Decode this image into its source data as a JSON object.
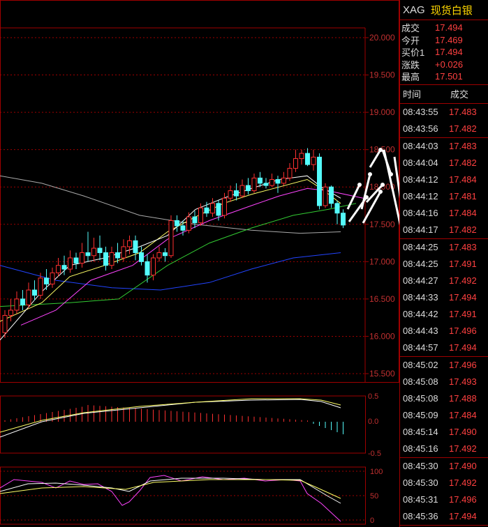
{
  "header": {
    "symbol": "XAG",
    "name": "现货白银"
  },
  "quote": [
    {
      "label": "成交",
      "value": "17.494"
    },
    {
      "label": "今开",
      "value": "17.469"
    },
    {
      "label": "买价1",
      "value": "17.494"
    },
    {
      "label": "涨跌",
      "value": "+0.026"
    },
    {
      "label": "最高",
      "value": "17.501"
    }
  ],
  "ticks_header": {
    "time": "时间",
    "price": "成交"
  },
  "tick_groups": [
    [
      {
        "time": "08:43:55",
        "price": "17.483"
      },
      {
        "time": "08:43:56",
        "price": "17.482"
      }
    ],
    [
      {
        "time": "08:44:03",
        "price": "17.483"
      },
      {
        "time": "08:44:04",
        "price": "17.482"
      },
      {
        "time": "08:44:12",
        "price": "17.484"
      },
      {
        "time": "08:44:12",
        "price": "17.481"
      },
      {
        "time": "08:44:16",
        "price": "17.484"
      },
      {
        "time": "08:44:17",
        "price": "17.482"
      }
    ],
    [
      {
        "time": "08:44:25",
        "price": "17.483"
      },
      {
        "time": "08:44:25",
        "price": "17.491"
      },
      {
        "time": "08:44:27",
        "price": "17.492"
      },
      {
        "time": "08:44:33",
        "price": "17.494"
      },
      {
        "time": "08:44:42",
        "price": "17.491"
      },
      {
        "time": "08:44:43",
        "price": "17.496"
      },
      {
        "time": "08:44:57",
        "price": "17.494"
      }
    ],
    [
      {
        "time": "08:45:02",
        "price": "17.496"
      },
      {
        "time": "08:45:08",
        "price": "17.493"
      },
      {
        "time": "08:45:08",
        "price": "17.488"
      },
      {
        "time": "08:45:09",
        "price": "17.484"
      },
      {
        "time": "08:45:14",
        "price": "17.490"
      },
      {
        "time": "08:45:16",
        "price": "17.492"
      }
    ],
    [
      {
        "time": "08:45:30",
        "price": "17.490"
      },
      {
        "time": "08:45:30",
        "price": "17.492"
      },
      {
        "time": "08:45:31",
        "price": "17.496"
      },
      {
        "time": "08:45:36",
        "price": "17.494"
      }
    ]
  ],
  "colors": {
    "up": "#ff3030",
    "down": "#54fcfc",
    "grid": "#a00000",
    "ma5": "#ffffff",
    "ma10": "#ffff66",
    "ma20": "#ff44ff",
    "ma40": "#33cc33",
    "ma60": "#aaaaaa",
    "ma120": "#2244ff"
  },
  "chart_data": {
    "type": "candlestick",
    "price_axis": {
      "ticks": [
        "20.000",
        "19.500",
        "19.000",
        "18.500",
        "18.000",
        "17.500",
        "17.000",
        "16.500",
        "16.000",
        "15.500"
      ],
      "ylim": [
        15.2,
        20.3
      ]
    },
    "candles": [
      [
        16.05,
        16.28,
        15.98,
        16.35
      ],
      [
        16.28,
        16.35,
        16.2,
        16.5
      ],
      [
        16.35,
        16.5,
        16.3,
        16.6
      ],
      [
        16.5,
        16.42,
        16.35,
        16.62
      ],
      [
        16.42,
        16.62,
        16.38,
        16.72
      ],
      [
        16.62,
        16.55,
        16.48,
        16.75
      ],
      [
        16.55,
        16.78,
        16.5,
        16.85
      ],
      [
        16.78,
        16.7,
        16.62,
        16.9
      ],
      [
        16.7,
        16.85,
        16.65,
        16.92
      ],
      [
        16.85,
        16.95,
        16.8,
        17.05
      ],
      [
        16.95,
        16.9,
        16.82,
        17.08
      ],
      [
        16.9,
        17.05,
        16.85,
        17.15
      ],
      [
        17.05,
        16.98,
        16.9,
        17.12
      ],
      [
        16.98,
        17.12,
        16.92,
        17.25
      ],
      [
        17.12,
        17.08,
        17.0,
        17.4
      ],
      [
        17.08,
        17.18,
        17.0,
        17.32
      ],
      [
        17.18,
        17.12,
        17.02,
        17.35
      ],
      [
        17.12,
        16.95,
        16.88,
        17.2
      ],
      [
        16.95,
        17.12,
        16.9,
        17.2
      ],
      [
        17.12,
        17.05,
        16.98,
        17.25
      ],
      [
        17.05,
        17.2,
        17.0,
        17.3
      ],
      [
        17.2,
        17.28,
        17.1,
        17.35
      ],
      [
        17.28,
        17.12,
        17.02,
        17.35
      ],
      [
        17.12,
        17.0,
        16.95,
        17.2
      ],
      [
        17.0,
        16.82,
        16.72,
        17.1
      ],
      [
        16.82,
        17.05,
        16.75,
        17.1
      ],
      [
        17.05,
        17.12,
        17.0,
        17.2
      ],
      [
        17.12,
        17.08,
        17.0,
        17.18
      ],
      [
        17.08,
        17.55,
        17.05,
        17.62
      ],
      [
        17.55,
        17.48,
        17.4,
        17.62
      ],
      [
        17.48,
        17.42,
        17.35,
        17.55
      ],
      [
        17.42,
        17.6,
        17.38,
        17.66
      ],
      [
        17.6,
        17.52,
        17.45,
        17.68
      ],
      [
        17.52,
        17.72,
        17.48,
        17.78
      ],
      [
        17.72,
        17.65,
        17.6,
        17.8
      ],
      [
        17.65,
        17.78,
        17.6,
        17.85
      ],
      [
        17.78,
        17.62,
        17.55,
        17.82
      ],
      [
        17.62,
        17.85,
        17.58,
        17.92
      ],
      [
        17.85,
        17.95,
        17.8,
        18.02
      ],
      [
        17.95,
        17.88,
        17.82,
        18.05
      ],
      [
        17.88,
        18.02,
        17.85,
        18.1
      ],
      [
        18.02,
        17.95,
        17.9,
        18.12
      ],
      [
        17.95,
        18.12,
        17.92,
        18.18
      ],
      [
        18.12,
        18.05,
        18.0,
        18.2
      ],
      [
        18.05,
        18.02,
        17.98,
        18.12
      ],
      [
        18.02,
        18.1,
        18.0,
        18.18
      ],
      [
        18.1,
        18.05,
        17.92,
        18.15
      ],
      [
        18.05,
        18.12,
        18.02,
        18.2
      ],
      [
        18.12,
        18.25,
        18.08,
        18.32
      ],
      [
        18.25,
        18.38,
        18.2,
        18.5
      ],
      [
        18.38,
        18.45,
        18.3,
        18.5
      ],
      [
        18.45,
        18.3,
        18.28,
        18.52
      ],
      [
        18.3,
        18.4,
        18.22,
        18.5
      ],
      [
        18.4,
        17.75,
        17.7,
        18.45
      ],
      [
        17.75,
        18.0,
        17.72,
        18.05
      ],
      [
        18.0,
        17.78,
        17.72,
        18.02
      ],
      [
        17.78,
        17.65,
        17.5,
        17.82
      ],
      [
        17.65,
        17.49,
        17.45,
        17.7
      ]
    ],
    "ma": {
      "ma5": [
        [
          0,
          15.95
        ],
        [
          60,
          16.6
        ],
        [
          100,
          16.95
        ],
        [
          150,
          17.05
        ],
        [
          200,
          17.2
        ],
        [
          240,
          17.35
        ],
        [
          280,
          17.7
        ],
        [
          320,
          17.85
        ],
        [
          360,
          17.98
        ],
        [
          400,
          18.1
        ],
        [
          440,
          18.15
        ],
        [
          460,
          18.0
        ],
        [
          488,
          17.85
        ]
      ],
      "ma10": [
        [
          0,
          16.2
        ],
        [
          60,
          16.45
        ],
        [
          100,
          16.8
        ],
        [
          150,
          16.95
        ],
        [
          200,
          17.12
        ],
        [
          240,
          17.4
        ],
        [
          280,
          17.6
        ],
        [
          320,
          17.78
        ],
        [
          360,
          17.9
        ],
        [
          400,
          18.0
        ],
        [
          440,
          18.1
        ],
        [
          460,
          17.98
        ],
        [
          488,
          17.78
        ]
      ],
      "ma20": [
        [
          30,
          16.15
        ],
        [
          80,
          16.35
        ],
        [
          130,
          16.75
        ],
        [
          190,
          16.95
        ],
        [
          240,
          17.3
        ],
        [
          300,
          17.55
        ],
        [
          360,
          17.75
        ],
        [
          400,
          17.88
        ],
        [
          440,
          17.98
        ],
        [
          470,
          17.95
        ],
        [
          520,
          17.85
        ]
      ],
      "ma40": [
        [
          0,
          16.4
        ],
        [
          100,
          16.45
        ],
        [
          170,
          16.5
        ],
        [
          240,
          16.95
        ],
        [
          300,
          17.25
        ],
        [
          360,
          17.45
        ],
        [
          420,
          17.62
        ],
        [
          470,
          17.7
        ],
        [
          510,
          17.78
        ]
      ],
      "ma60": [
        [
          0,
          18.15
        ],
        [
          60,
          18.05
        ],
        [
          120,
          17.88
        ],
        [
          200,
          17.62
        ],
        [
          280,
          17.5
        ],
        [
          360,
          17.42
        ],
        [
          430,
          17.38
        ],
        [
          488,
          17.4
        ]
      ],
      "ma120": [
        [
          0,
          16.95
        ],
        [
          80,
          16.75
        ],
        [
          160,
          16.65
        ],
        [
          230,
          16.62
        ],
        [
          300,
          16.72
        ],
        [
          360,
          16.9
        ],
        [
          420,
          17.05
        ],
        [
          488,
          17.12
        ]
      ]
    },
    "macd_axis": [
      "0.5",
      "0.0",
      "-0.5"
    ],
    "rsi_axis": [
      "100",
      "50",
      "0"
    ]
  }
}
